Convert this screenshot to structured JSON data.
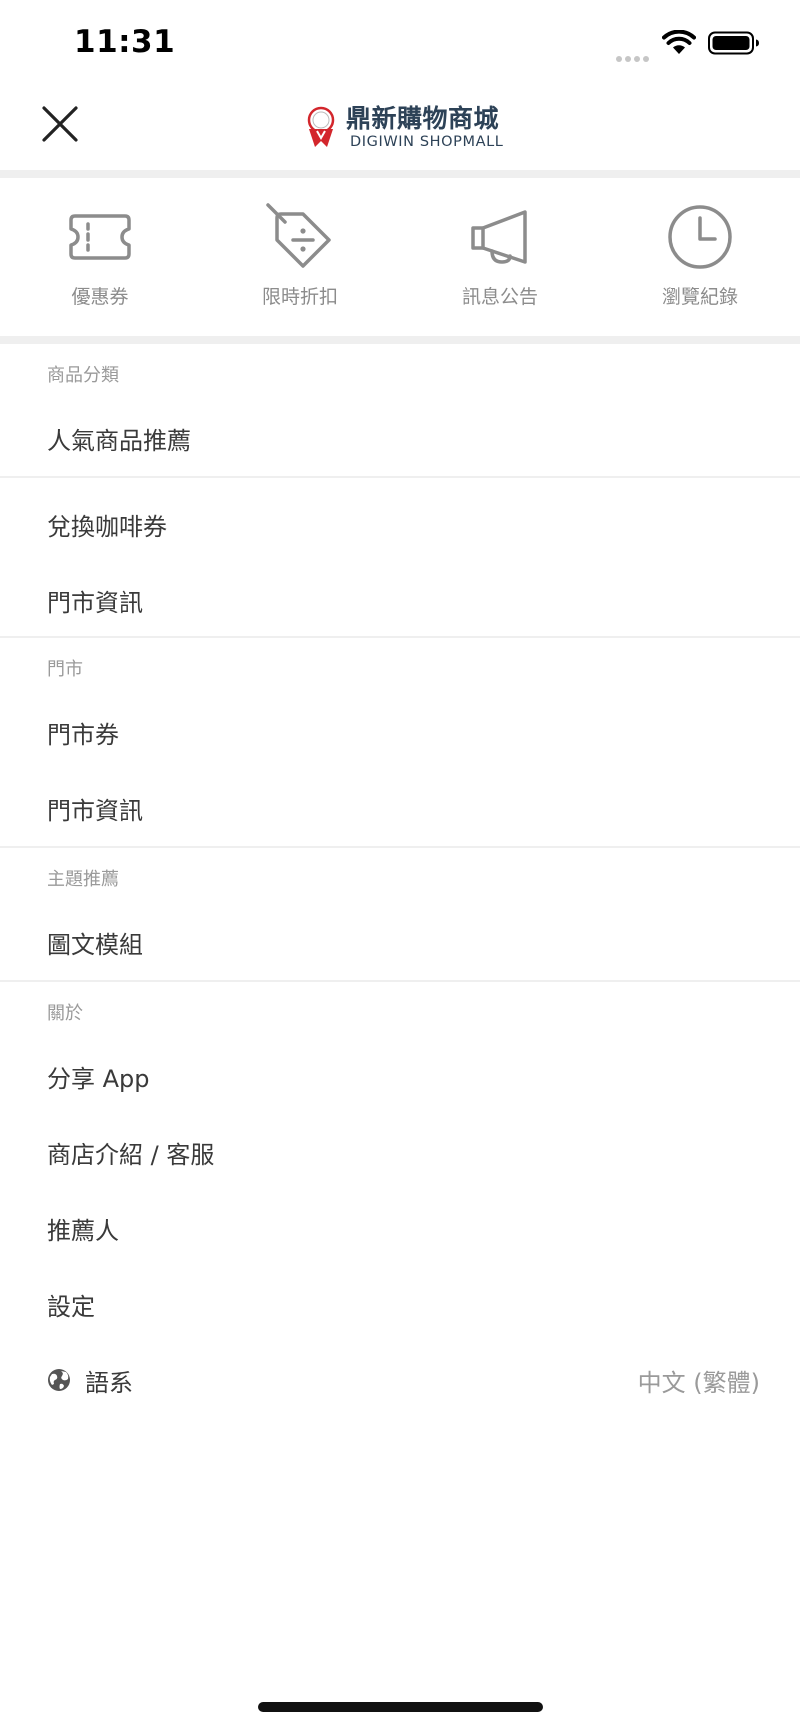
{
  "status_bar": {
    "time": "11:31"
  },
  "header": {
    "logo_zh": "鼎新購物商城",
    "logo_en": "DIGIWIN SHOPMALL",
    "icons": [
      "close-icon",
      "logo-icon"
    ]
  },
  "shortcuts": [
    {
      "label": "優惠券",
      "icon": "coupon-ticket-icon"
    },
    {
      "label": "限時折扣",
      "icon": "discount-tag-icon"
    },
    {
      "label": "訊息公告",
      "icon": "megaphone-icon"
    },
    {
      "label": "瀏覽紀錄",
      "icon": "clock-icon"
    }
  ],
  "menu": {
    "section_products": "商品分類",
    "products_items": [
      "人氣商品推薦"
    ],
    "misc_items": [
      "兌換咖啡券",
      "門市資訊"
    ],
    "section_store": "門市",
    "store_items": [
      "門市券",
      "門市資訊"
    ],
    "section_theme": "主題推薦",
    "theme_items": [
      "圖文模組"
    ],
    "section_about": "關於",
    "about_items": [
      "分享 App",
      "商店介紹 / 客服",
      "推薦人",
      "設定"
    ],
    "language_label": "語系",
    "language_value": "中文 (繁體)",
    "language_icon": "globe-icon"
  },
  "colors": {
    "brand": "#2d4257",
    "logo_red": "#d3262c",
    "icon_gray": "#8c8c8c",
    "divider": "#efefef"
  }
}
